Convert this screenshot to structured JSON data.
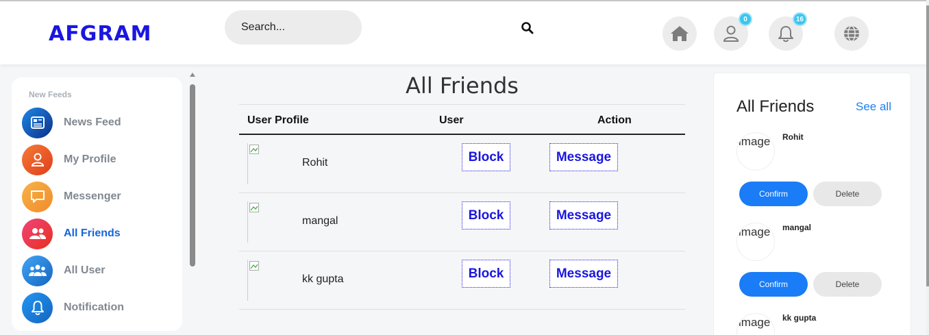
{
  "header": {
    "logo": "AFGRAM",
    "search_placeholder": "Search...",
    "profile_badge": "0",
    "notifications_badge": "16"
  },
  "sidebar": {
    "section_title": "New Feeds",
    "items": [
      {
        "label": "News Feed",
        "icon": "newspaper-icon",
        "color": "#1565d8"
      },
      {
        "label": "My Profile",
        "icon": "user-icon",
        "color": "#f05a28"
      },
      {
        "label": "Messenger",
        "icon": "chat-icon",
        "color": "#f5a33a"
      },
      {
        "label": "All Friends",
        "icon": "users-icon",
        "color": "#e91e63"
      },
      {
        "label": "All User",
        "icon": "users-group-icon",
        "color": "#1e88e5"
      },
      {
        "label": "Notification",
        "icon": "bell-icon",
        "color": "#1e88e5"
      }
    ]
  },
  "main": {
    "title": "All Friends",
    "columns": [
      "User Profile",
      "User",
      "Action"
    ],
    "rows": [
      {
        "name": "Rohit",
        "block_label": "Block",
        "message_label": "Message"
      },
      {
        "name": "mangal",
        "block_label": "Block",
        "message_label": "Message"
      },
      {
        "name": "kk gupta",
        "block_label": "Block",
        "message_label": "Message"
      }
    ]
  },
  "right_panel": {
    "title": "All Friends",
    "see_all": "See all",
    "requests": [
      {
        "name": "Rohit",
        "img_alt": "image",
        "confirm": "Confirm",
        "delete": "Delete"
      },
      {
        "name": "mangal",
        "img_alt": "image",
        "confirm": "Confirm",
        "delete": "Delete"
      },
      {
        "name": "kk gupta",
        "img_alt": "image"
      }
    ]
  },
  "colors": {
    "brand": "#1a16e0",
    "accent": "#1a7cf6",
    "active_nav": "#1565d8"
  }
}
